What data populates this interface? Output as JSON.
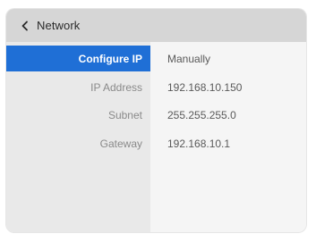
{
  "header": {
    "title": "Network",
    "back_icon": "chevron-left-icon"
  },
  "settings": {
    "rows": [
      {
        "label": "Configure IP",
        "value": "Manually",
        "selected": true
      },
      {
        "label": "IP Address",
        "value": "192.168.10.150",
        "selected": false
      },
      {
        "label": "Subnet",
        "value": "255.255.255.0",
        "selected": false
      },
      {
        "label": "Gateway",
        "value": "192.168.10.1",
        "selected": false
      }
    ]
  },
  "colors": {
    "selection": "#1f6fd6",
    "header_bg": "#d6d6d6",
    "label_column_bg": "#e9e9e9",
    "value_column_bg": "#f5f5f5"
  }
}
